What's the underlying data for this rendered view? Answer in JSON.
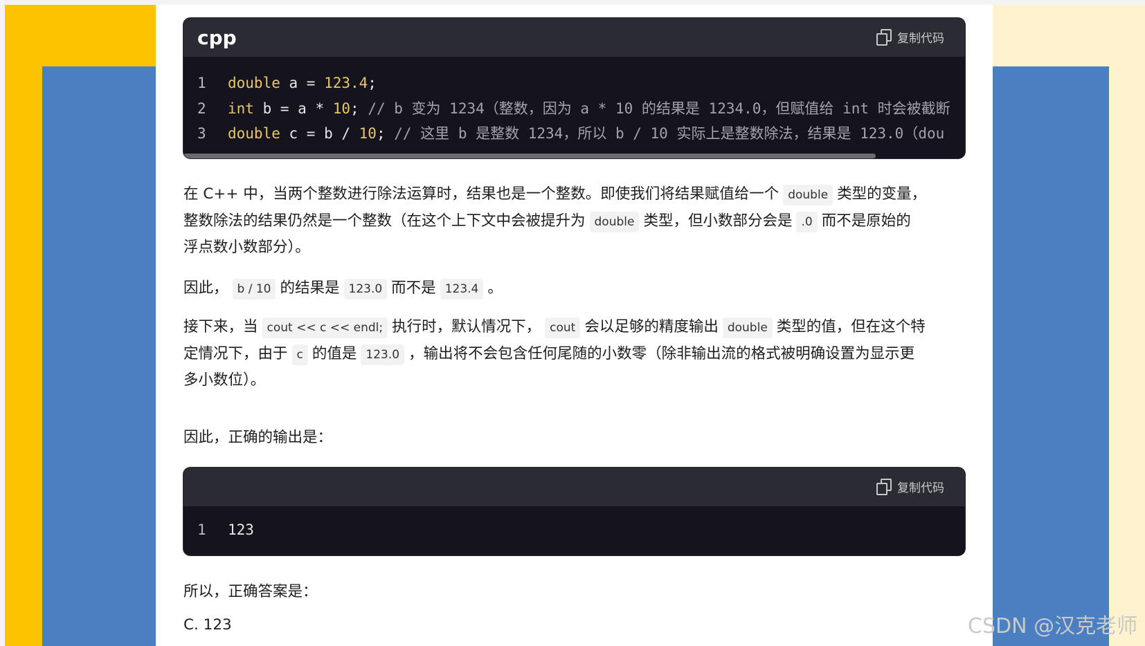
{
  "code_block_1": {
    "lang": "cpp",
    "copy_label": "复制代码",
    "lines": [
      {
        "n": "1",
        "segments": [
          [
            "kw",
            "double"
          ],
          [
            "tx",
            " a = "
          ],
          [
            "num",
            "123.4"
          ],
          [
            "tx",
            ";"
          ]
        ]
      },
      {
        "n": "2",
        "segments": [
          [
            "kw",
            "int"
          ],
          [
            "tx",
            " b = a * "
          ],
          [
            "num",
            "10"
          ],
          [
            "tx",
            "; "
          ],
          [
            "cm",
            "// b 变为 1234（整数，因为 a * 10 的结果是 1234.0，但赋值给 int 时会被截断"
          ]
        ]
      },
      {
        "n": "3",
        "segments": [
          [
            "kw",
            "double"
          ],
          [
            "tx",
            " c = b / "
          ],
          [
            "num",
            "10"
          ],
          [
            "tx",
            "; "
          ],
          [
            "cm",
            "// 这里 b 是整数 1234，所以 b / 10 实际上是整数除法，结果是 123.0（dou"
          ]
        ]
      }
    ]
  },
  "para1": {
    "line1_a": "在 C++ 中，当两个整数进行除法运算时，结果也是一个整数。即使我们将结果赋值给一个",
    "line1_code": "double",
    "line1_b": "类型的变量，",
    "line2_a": "整数除法的结果仍然是一个整数（在这个上下文中会被提升为",
    "line2_code": "double",
    "line2_b": "类型，但小数部分会是",
    "line2_code2": ".0",
    "line2_c": "而不是原始的",
    "line3": "浮点数小数部分）。"
  },
  "para2": {
    "a": "因此，",
    "code1": "b / 10",
    "b": "的结果是",
    "code2": "123.0",
    "c": "而不是",
    "code3": "123.4",
    "d": "。"
  },
  "para3": {
    "a": "接下来，当",
    "code1": "cout << c << endl;",
    "b": "执行时，默认情况下，",
    "code2": "cout",
    "c": "会以足够的精度输出",
    "code3": "double",
    "d": "类型的值，但在这个特",
    "line2_a": "定情况下，由于",
    "line2_code1": "c",
    "line2_b": "的值是",
    "line2_code2": "123.0",
    "line2_c": "，输出将不会包含任何尾随的小数零（除非输出流的格式被明确设置为显示更",
    "line3": "多小数位）。"
  },
  "para4": "因此，正确的输出是：",
  "code_block_2": {
    "copy_label": "复制代码",
    "lines": [
      {
        "n": "1",
        "text": "123"
      }
    ]
  },
  "para5": "所以，正确答案是：",
  "para6": "C. 123",
  "watermark": "CSDN @汉克老师",
  "colors": {
    "yellow": "#fdc200",
    "blue": "#4a7fc1",
    "cream": "#fff2cf",
    "code_bg": "#15141c",
    "code_header": "#2b2b33",
    "keyword": "#e8c76a"
  }
}
